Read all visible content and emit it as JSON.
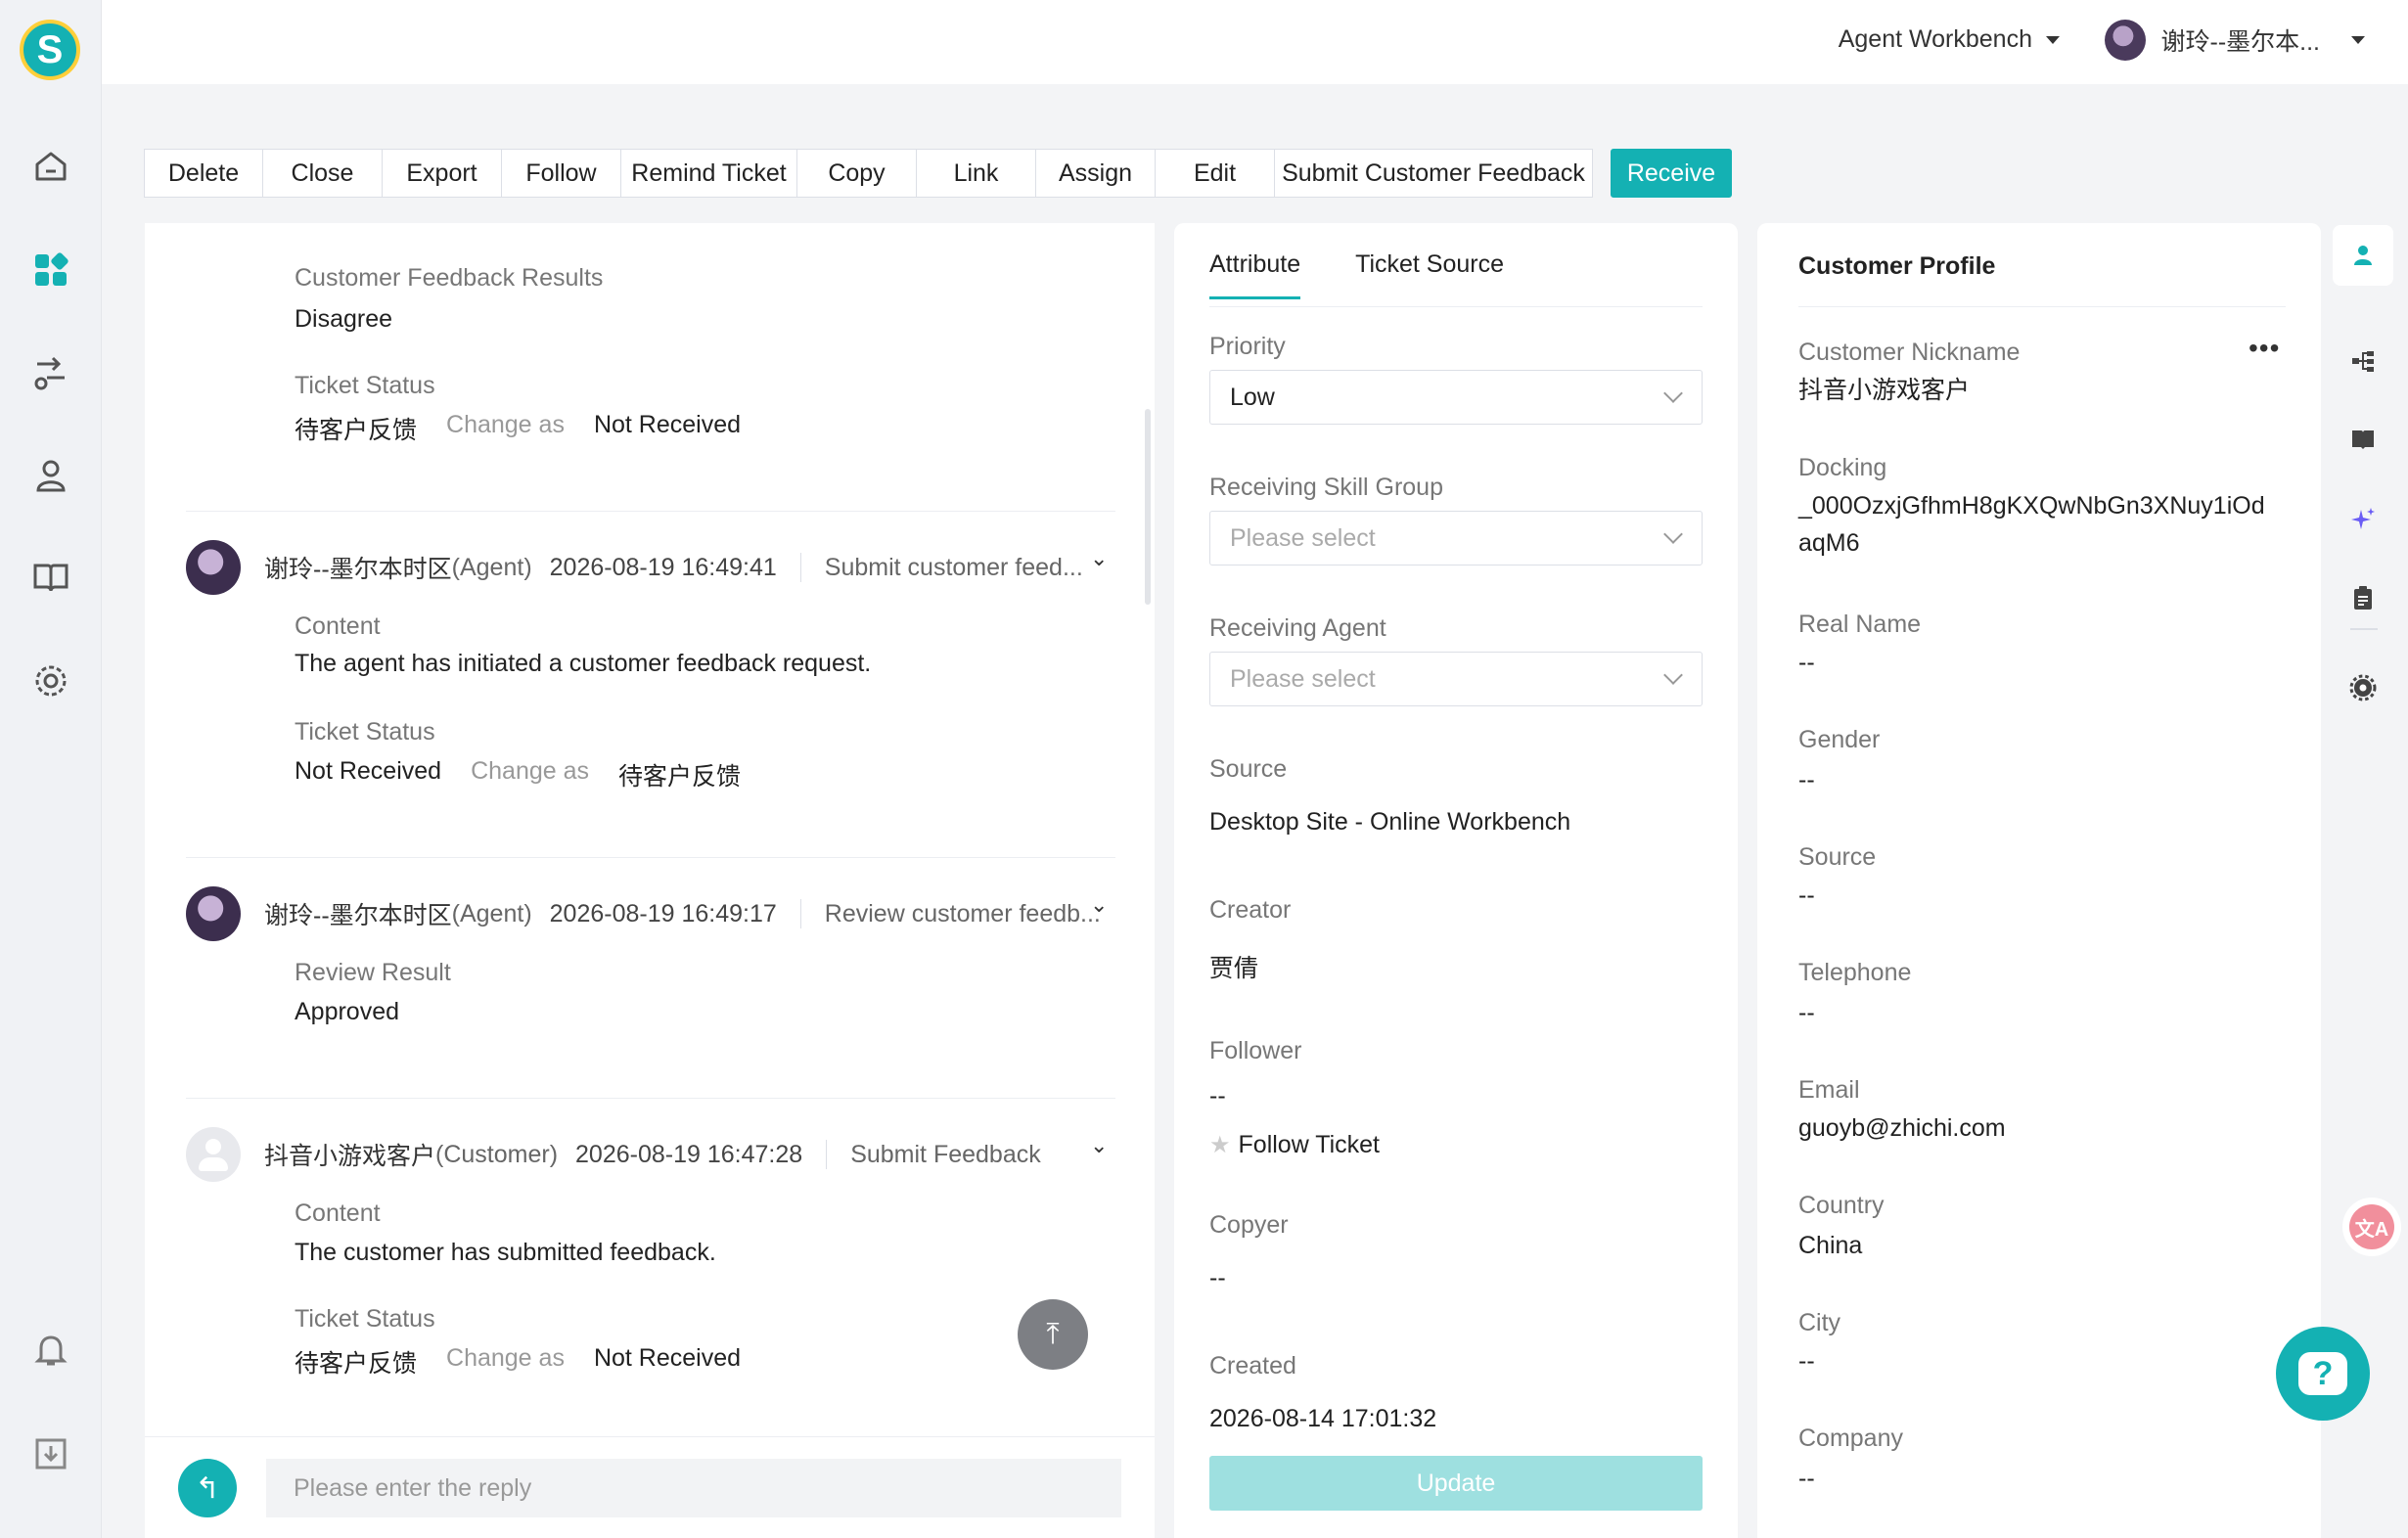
{
  "header": {
    "workbench_label": "Agent Workbench",
    "user_name": "谢玲--墨尔本..."
  },
  "toolbar": {
    "buttons": [
      "Delete",
      "Close",
      "Export",
      "Follow",
      "Remind Ticket",
      "Copy",
      "Link",
      "Assign",
      "Edit",
      "Submit Customer Feedback"
    ],
    "primary": "Receive"
  },
  "timeline": {
    "entry0": {
      "result_label": "Customer Feedback Results",
      "result_value": "Disagree",
      "status_label": "Ticket Status",
      "from": "待客户反馈",
      "change": "Change as",
      "to": "Not Received"
    },
    "entry1": {
      "name": "谢玲--墨尔本时区",
      "role": "(Agent)",
      "time": "2026-08-19 16:49:41",
      "action": "Submit customer feed...",
      "content_label": "Content",
      "content": "The agent has initiated a customer feedback request.",
      "status_label": "Ticket Status",
      "from": "Not Received",
      "change": "Change as",
      "to": "待客户反馈"
    },
    "entry2": {
      "name": "谢玲--墨尔本时区",
      "role": "(Agent)",
      "time": "2026-08-19 16:49:17",
      "action": "Review customer feedb...",
      "result_label": "Review Result",
      "result_value": "Approved"
    },
    "entry3": {
      "name": "抖音小游戏客户",
      "role": "(Customer)",
      "time": "2026-08-19 16:47:28",
      "action": "Submit Feedback",
      "content_label": "Content",
      "content": "The customer has submitted feedback.",
      "status_label": "Ticket Status",
      "from": "待客户反馈",
      "change": "Change as",
      "to": "Not Received"
    },
    "reply_placeholder": "Please enter the reply"
  },
  "attributes": {
    "tabs": [
      "Attribute",
      "Ticket Source"
    ],
    "priority_label": "Priority",
    "priority_value": "Low",
    "skill_group_label": "Receiving Skill Group",
    "skill_group_placeholder": "Please select",
    "agent_label": "Receiving Agent",
    "agent_placeholder": "Please select",
    "source_label": "Source",
    "source_value": "Desktop Site - Online Workbench",
    "creator_label": "Creator",
    "creator_value": "贾倩",
    "follower_label": "Follower",
    "follower_value": "--",
    "follow_ticket": "Follow Ticket",
    "copyer_label": "Copyer",
    "copyer_value": "--",
    "created_label": "Created",
    "created_value": "2026-08-14 17:01:32",
    "update_button": "Update"
  },
  "profile": {
    "title": "Customer Profile",
    "fields": [
      {
        "label": "Customer Nickname",
        "value": "抖音小游戏客户"
      },
      {
        "label": "Docking",
        "value": "_000OzxjGfhmH8gKXQwNbGn3XNuy1iOdaqM6"
      },
      {
        "label": "Real Name",
        "value": "--"
      },
      {
        "label": "Gender",
        "value": "--"
      },
      {
        "label": "Source",
        "value": "--"
      },
      {
        "label": "Telephone",
        "value": "--"
      },
      {
        "label": "Email",
        "value": "guoyb@zhichi.com"
      },
      {
        "label": "Country",
        "value": "China"
      },
      {
        "label": "City",
        "value": "--"
      },
      {
        "label": "Company",
        "value": "--"
      }
    ]
  },
  "colors": {
    "accent": "#14b1b3",
    "logo_ring": "#ffcf3a"
  }
}
